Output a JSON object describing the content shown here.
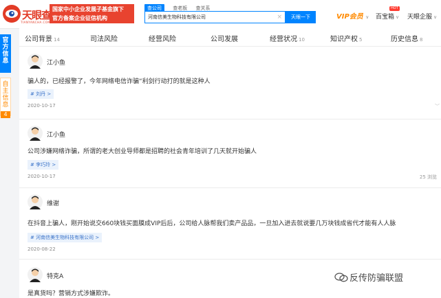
{
  "header": {
    "logo_text": "天眼查",
    "logo_sub": "TIANYANCHA.COM",
    "banner_line1": "国家中小企业发展子基金旗下",
    "banner_line2": "官方备案企业征信机构",
    "search_tabs": [
      "查公司",
      "查老板",
      "查关系"
    ],
    "search_value": "河南信美生物科技有限公司",
    "search_clear": "×",
    "search_button": "天眼一下",
    "vip_label": "VIP会员",
    "baibaoxiang": "百宝箱",
    "hot_badge": "HOT",
    "enterprise": "天眼企服",
    "dropdown_arrow": "∨"
  },
  "sidebar": {
    "official": "官方信息",
    "self": "自主信息",
    "self_count": "4"
  },
  "tabs": [
    {
      "label": "公司背景",
      "count": "14"
    },
    {
      "label": "司法风险",
      "count": ""
    },
    {
      "label": "经营风险",
      "count": ""
    },
    {
      "label": "公司发展",
      "count": ""
    },
    {
      "label": "经营状况",
      "count": "10"
    },
    {
      "label": "知识产权",
      "count": "5"
    },
    {
      "label": "历史信息",
      "count": "8"
    }
  ],
  "comments": [
    {
      "user": "江小鱼",
      "text": "骗人的，已经报警了，今年网络电信诈骗“利剑行动打的就是这种人",
      "tag": "# 刘丹 >",
      "date": "2020-10-17",
      "views": ""
    },
    {
      "user": "江小鱼",
      "text": "公司涉嫌网络诈骗，所谓的老大创业导师都是招聘的社会青年培训了几天就开始骗人",
      "tag": "# 李巧玲 >",
      "date": "2020-10-17",
      "views": "25 浏览"
    },
    {
      "user": "维谢",
      "text": "在抖音上骗人，刚开始说交660块钱买面膜成VIP后后，公司给人脉帮我们卖产品品，一旦加入进去就说要几万块钱成省代才能有人人脉",
      "tag": "# 河南信美生物科技有限公司 >",
      "date": "2020-08-22",
      "views": ""
    },
    {
      "user": "特克A",
      "text": "是真货吗？营销方式涉嫌欺诈。",
      "tag": "",
      "date": "",
      "views": ""
    }
  ],
  "watermark": "反传防骗联盟",
  "colors": {
    "brand_blue": "#0084ff",
    "brand_red": "#e23b26",
    "vip_orange": "#ff8a00"
  }
}
